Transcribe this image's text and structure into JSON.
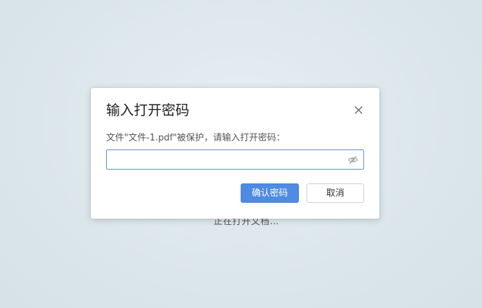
{
  "background": {
    "status_text": "正在打开文档…"
  },
  "dialog": {
    "title": "输入打开密码",
    "message": "文件\"文件-1.pdf\"被保护，请输入打开密码：",
    "password_value": "",
    "password_placeholder": "",
    "confirm_label": "确认密码",
    "cancel_label": "取消",
    "icons": {
      "close": "close-icon",
      "toggle_visibility": "eye-off-icon"
    }
  },
  "colors": {
    "accent": "#4f8ae3",
    "input_border": "#5b8fdc",
    "background": "#dbe6eb"
  }
}
